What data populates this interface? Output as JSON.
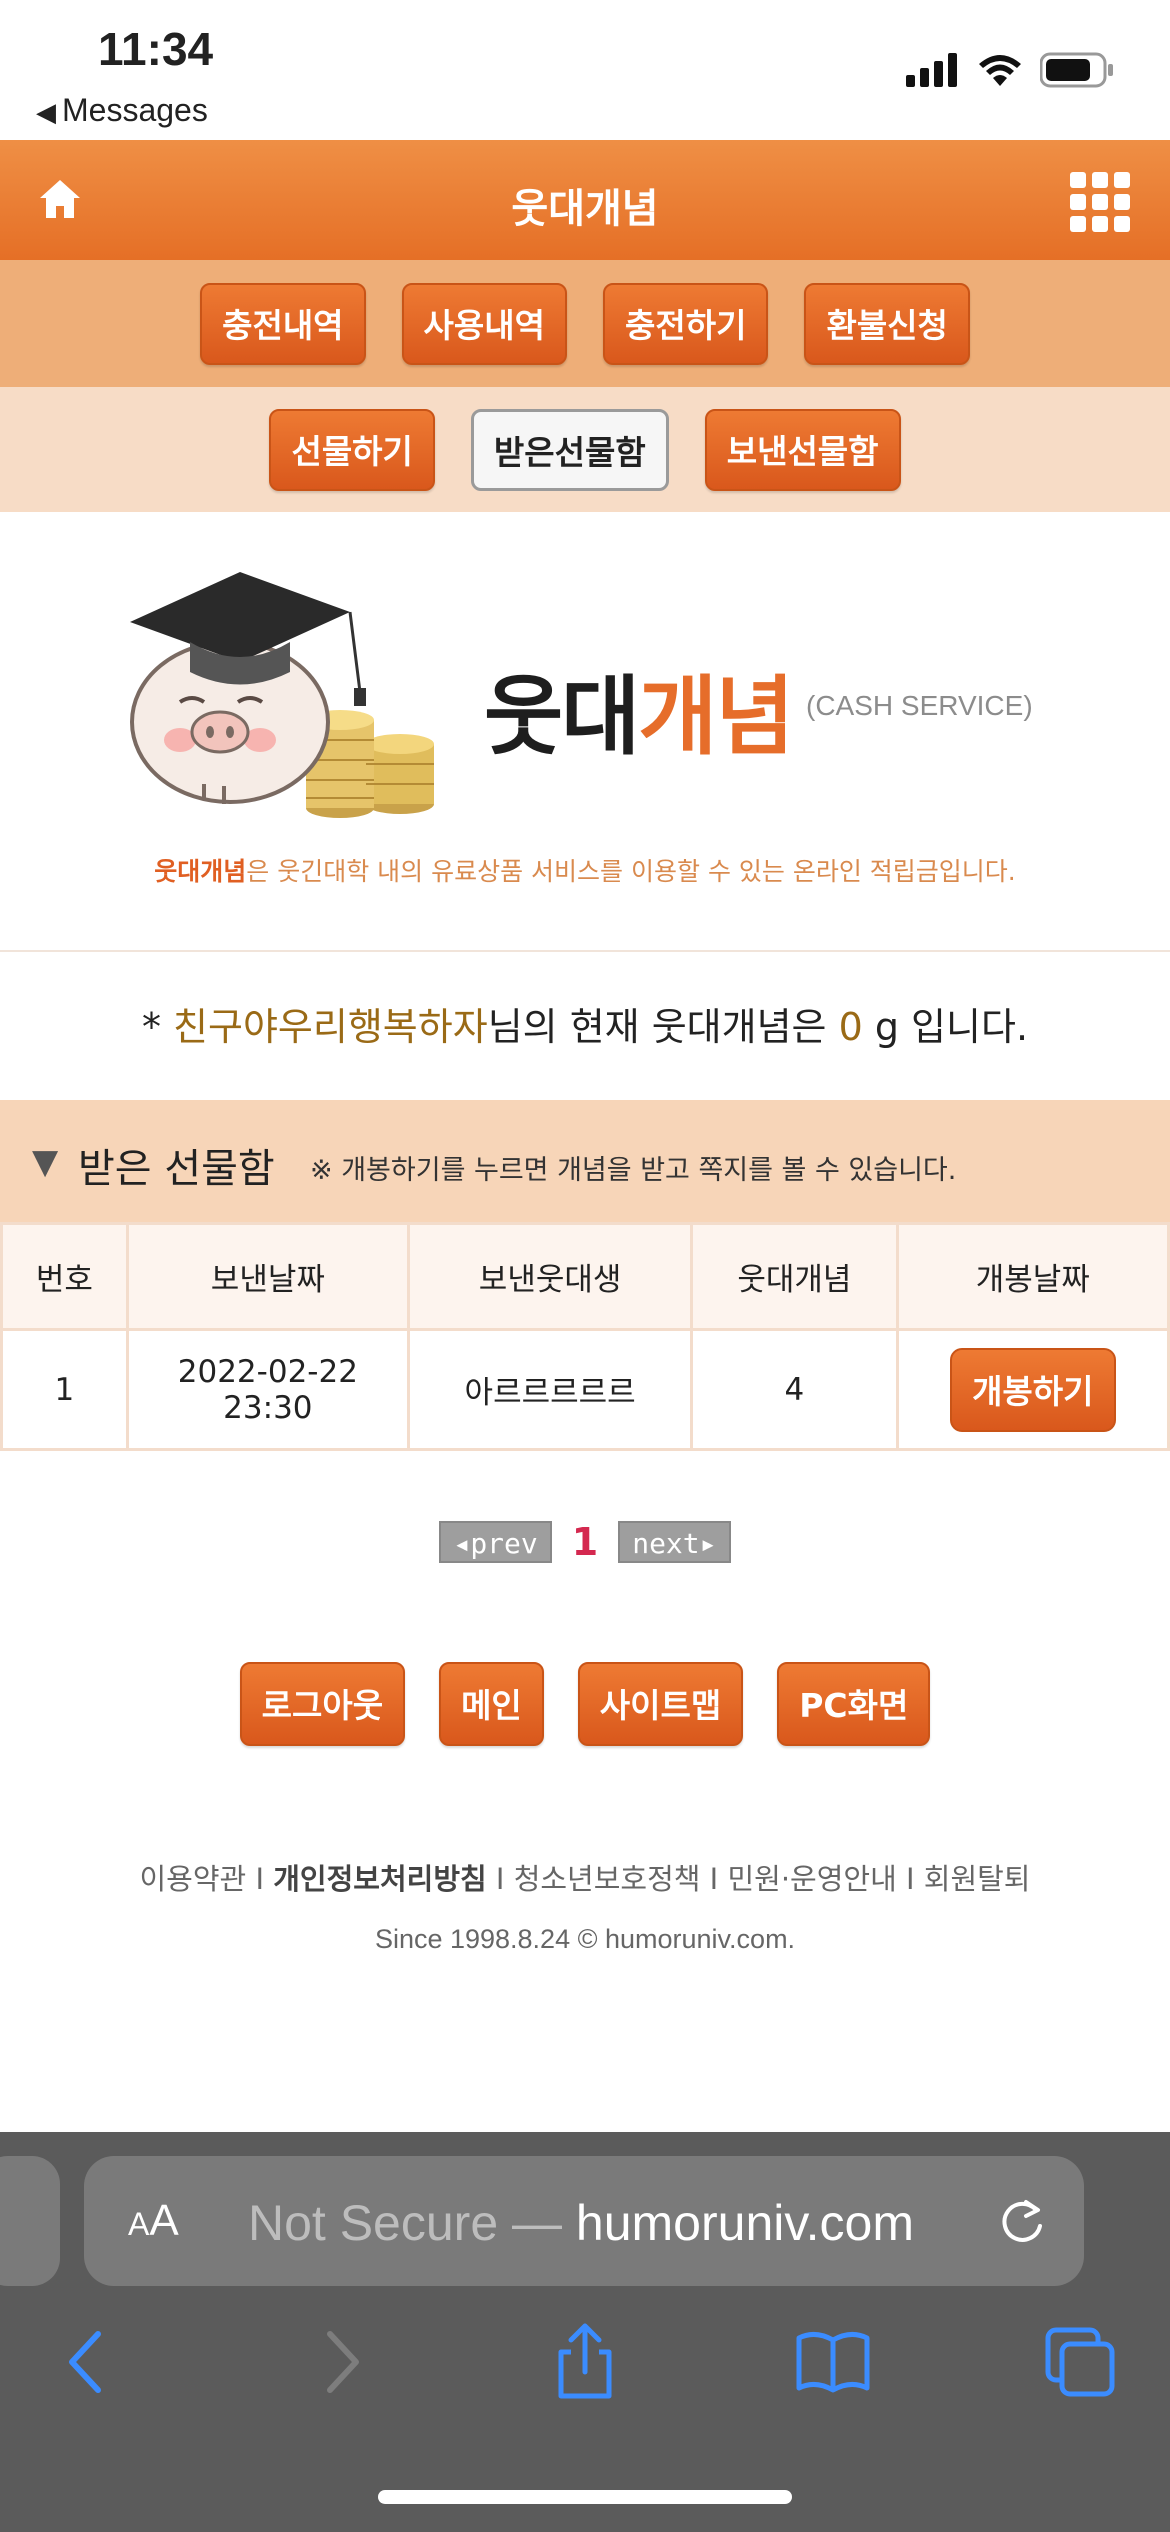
{
  "status": {
    "time": "11:34",
    "back_label": "Messages"
  },
  "header": {
    "title": "웃대개념"
  },
  "menu_row1": [
    "충전내역",
    "사용내역",
    "충전하기",
    "환불신청"
  ],
  "menu_row2": [
    "선물하기",
    "받은선물함",
    "보낸선물함"
  ],
  "logo": {
    "text_dark": "웃대",
    "text_orange": "개념",
    "subtitle": "(CASH SERVICE)"
  },
  "description": {
    "highlight": "웃대개념",
    "rest": "은 웃긴대학 내의 유료상품 서비스를 이용할 수 있는 온라인 적립금입니다."
  },
  "balance": {
    "prefix": "* ",
    "username": "친구야우리행복하자",
    "middle": "님의 현재 웃대개념은 ",
    "amount": "0",
    "suffix": " g 입니다."
  },
  "section": {
    "title": "받은 선물함",
    "note": "※ 개봉하기를 누르면 개념을 받고 쪽지를 볼 수 있습니다."
  },
  "table": {
    "headers": [
      "번호",
      "보낸날짜",
      "보낸웃대생",
      "웃대개념",
      "개봉날짜"
    ],
    "rows": [
      {
        "no": "1",
        "date": "2022-02-22",
        "time": "23:30",
        "sender": "아르르르르르",
        "amount": "4",
        "action": "개봉하기"
      }
    ]
  },
  "pager": {
    "prev": "◂prev",
    "current": "1",
    "next": "next▸"
  },
  "bottom_buttons": [
    "로그아웃",
    "메인",
    "사이트맵",
    "PC화면"
  ],
  "footer": {
    "links": [
      "이용약관",
      "개인정보처리방침",
      "청소년보호정책",
      "민원·운영안내",
      "회원탈퇴"
    ],
    "separator": " I ",
    "since": "Since 1998.8.24  © humoruniv.com."
  },
  "safari": {
    "aa": "A",
    "aa_big": "A",
    "not_secure": "Not Secure — ",
    "domain": "humoruniv.com"
  },
  "colors": {
    "accent": "#e56f26",
    "menu_row1_bg": "#eeae78",
    "menu_row2_bg": "#f7dcc6",
    "section_bg": "#f7d5b8",
    "safari_bg": "#5b5b5b"
  }
}
